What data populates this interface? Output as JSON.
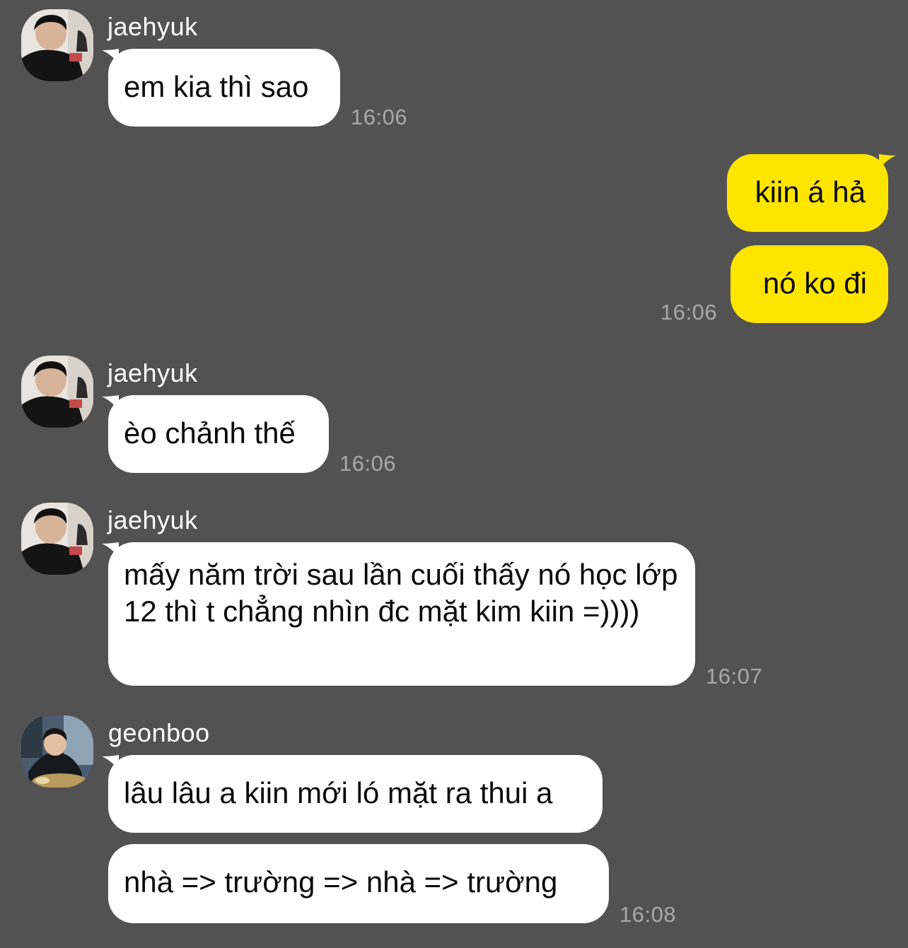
{
  "chat": {
    "colors": {
      "background": "#535253",
      "incoming_bubble": "#ffffff",
      "outgoing_bubble": "#fee500",
      "timestamp": "#a9a9a9"
    },
    "groups": [
      {
        "sender": "jaehyuk",
        "avatar": "jaehyuk-avatar",
        "messages": [
          "em kia thì sao"
        ],
        "time": "16:06"
      },
      {
        "sender": "me",
        "outgoing": true,
        "messages": [
          "kiin á hả",
          "nó ko đi"
        ],
        "time": "16:06"
      },
      {
        "sender": "jaehyuk",
        "avatar": "jaehyuk-avatar",
        "messages": [
          "èo chảnh thế"
        ],
        "time": "16:06"
      },
      {
        "sender": "jaehyuk",
        "avatar": "jaehyuk-avatar",
        "messages": [
          "mấy năm trời sau lần cuối thấy nó học lớp 12 thì t chẳng nhìn đc mặt kim kiin =))))"
        ],
        "time": "16:07"
      },
      {
        "sender": "geonboo",
        "avatar": "geonboo-avatar",
        "messages": [
          "lâu lâu a kiin mới ló mặt ra thui a",
          "nhà => trường => nhà => trường"
        ],
        "time": "16:08"
      }
    ]
  }
}
